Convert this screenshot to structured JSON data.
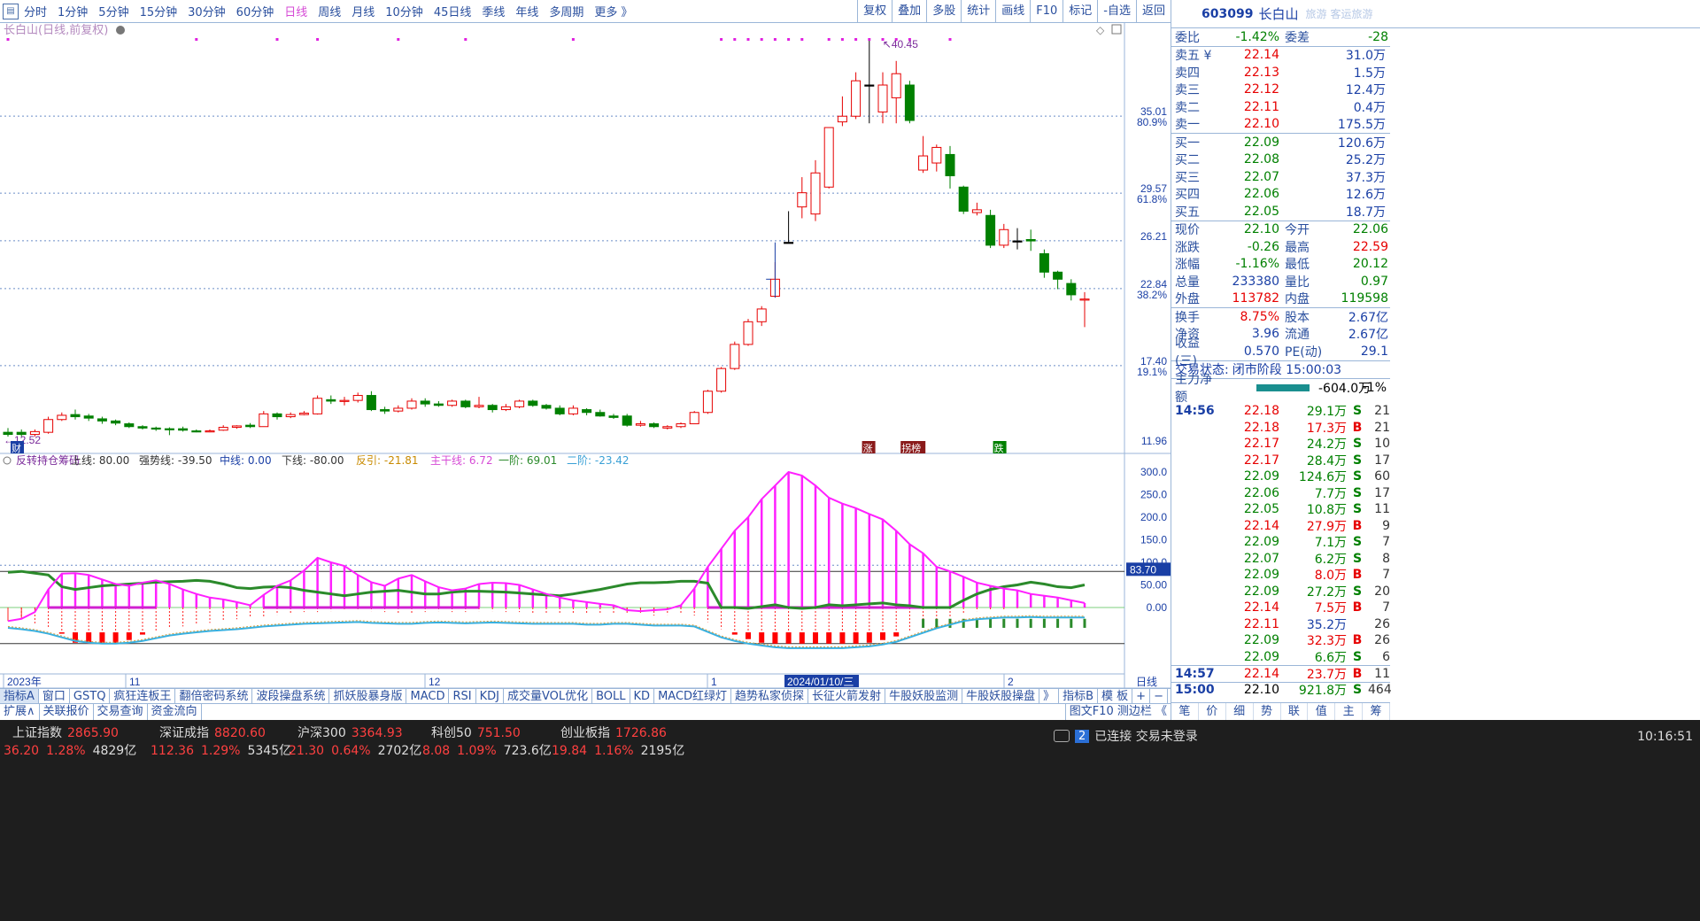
{
  "toolbar": {
    "periods": [
      "分时",
      "1分钟",
      "5分钟",
      "15分钟",
      "30分钟",
      "60分钟",
      "日线",
      "周线",
      "月线",
      "10分钟",
      "45日线",
      "季线",
      "年线",
      "多周期",
      "更多 》"
    ],
    "active": "日线",
    "right": [
      "复权",
      "叠加",
      "多股",
      "统计",
      "画线",
      "F10",
      "标记",
      "-自选",
      "返回"
    ]
  },
  "chart_title": "长白山(日线,前复权)",
  "price_labels": [
    "35.01",
    "80.9%",
    "29.57",
    "61.8%",
    "26.21",
    "22.84",
    "38.2%",
    "17.40",
    "19.1%",
    "11.96"
  ],
  "high_mark": "40.45",
  "low_mark": "12.52",
  "event_labels": [
    "财",
    "涨",
    "拐榜",
    "跌"
  ],
  "indicator_header": {
    "name": "反转持仓筹码",
    "items": [
      "上线: 80.00",
      "强势线: -39.50",
      "中线: 0.00",
      "下线: -80.00",
      "反引: -21.81",
      "主干线: 6.72",
      "一阶: 69.01",
      "二阶: -23.42"
    ]
  },
  "ind_axis": [
    "300.0",
    "250.0",
    "200.0",
    "150.0",
    "100.0",
    "50.00",
    "0.00"
  ],
  "ind_tag": "83.70",
  "x_labels": [
    "2023年",
    "11",
    "12",
    "1",
    "2"
  ],
  "x_highlight": "2024/01/10/三",
  "x_right": "日线",
  "stock": {
    "code": "603099",
    "name": "长白山",
    "tags": [
      "旅游",
      "客运旅游"
    ]
  },
  "weibi": {
    "label": "委比",
    "value": "-1.42%",
    "label2": "委差",
    "value2": "-28"
  },
  "asks": [
    {
      "label": "卖五 ¥",
      "price": "22.14",
      "vol": "31.0万"
    },
    {
      "label": "卖四",
      "price": "22.13",
      "vol": "1.5万"
    },
    {
      "label": "卖三",
      "price": "22.12",
      "vol": "12.4万"
    },
    {
      "label": "卖二",
      "price": "22.11",
      "vol": "0.4万"
    },
    {
      "label": "卖一",
      "price": "22.10",
      "vol": "175.5万"
    }
  ],
  "bids": [
    {
      "label": "买一",
      "price": "22.09",
      "vol": "120.6万"
    },
    {
      "label": "买二",
      "price": "22.08",
      "vol": "25.2万"
    },
    {
      "label": "买三",
      "price": "22.07",
      "vol": "37.3万"
    },
    {
      "label": "买四",
      "price": "22.06",
      "vol": "12.6万"
    },
    {
      "label": "买五",
      "price": "22.05",
      "vol": "18.7万"
    }
  ],
  "stats1": [
    {
      "l": "现价",
      "v": "22.10",
      "l2": "今开",
      "v2": "22.06",
      "c": "grn",
      "c2": "grn"
    },
    {
      "l": "涨跌",
      "v": "-0.26",
      "l2": "最高",
      "v2": "22.59",
      "c": "grn",
      "c2": "red"
    },
    {
      "l": "涨幅",
      "v": "-1.16%",
      "l2": "最低",
      "v2": "20.12",
      "c": "grn",
      "c2": "grn"
    },
    {
      "l": "总量",
      "v": "233380",
      "l2": "量比",
      "v2": "0.97",
      "c": "blu",
      "c2": "grn"
    },
    {
      "l": "外盘",
      "v": "113782",
      "l2": "内盘",
      "v2": "119598",
      "c": "red",
      "c2": "grn"
    }
  ],
  "stats2": [
    {
      "l": "换手",
      "v": "8.75%",
      "l2": "股本",
      "v2": "2.67亿",
      "c": "red",
      "c2": "blu"
    },
    {
      "l": "净资",
      "v": "3.96",
      "l2": "流通",
      "v2": "2.67亿",
      "c": "blu",
      "c2": "blu"
    },
    {
      "l": "收益(三)",
      "v": "0.570",
      "l2": "PE(动)",
      "v2": "29.1",
      "c": "blu",
      "c2": "blu"
    }
  ],
  "trade_state": {
    "label": "交易状态:",
    "value": "闭市阶段 15:00:03"
  },
  "main_net": {
    "label": "主力净额",
    "value": "-604.0万",
    "pct": "-1%"
  },
  "ticks": [
    {
      "t": "14:56",
      "p": "22.18",
      "v": "29.1万",
      "bs": "S",
      "n": "21"
    },
    {
      "t": "",
      "p": "22.18",
      "v": "17.3万",
      "bs": "B",
      "n": "21"
    },
    {
      "t": "",
      "p": "22.17",
      "v": "24.2万",
      "bs": "S",
      "n": "10"
    },
    {
      "t": "",
      "p": "22.17",
      "v": "28.4万",
      "bs": "S",
      "n": "17"
    },
    {
      "t": "",
      "p": "22.09",
      "v": "124.6万",
      "bs": "S",
      "n": "60"
    },
    {
      "t": "",
      "p": "22.06",
      "v": "7.7万",
      "bs": "S",
      "n": "17"
    },
    {
      "t": "",
      "p": "22.05",
      "v": "10.8万",
      "bs": "S",
      "n": "11"
    },
    {
      "t": "",
      "p": "22.14",
      "v": "27.9万",
      "bs": "B",
      "n": "9"
    },
    {
      "t": "",
      "p": "22.09",
      "v": "7.1万",
      "bs": "S",
      "n": "7"
    },
    {
      "t": "",
      "p": "22.07",
      "v": "6.2万",
      "bs": "S",
      "n": "8"
    },
    {
      "t": "",
      "p": "22.09",
      "v": "8.0万",
      "bs": "B",
      "n": "7"
    },
    {
      "t": "",
      "p": "22.09",
      "v": "27.2万",
      "bs": "S",
      "n": "20"
    },
    {
      "t": "",
      "p": "22.14",
      "v": "7.5万",
      "bs": "B",
      "n": "7"
    },
    {
      "t": "",
      "p": "22.11",
      "v": "35.2万",
      "bs": "",
      "n": "26"
    },
    {
      "t": "",
      "p": "22.09",
      "v": "32.3万",
      "bs": "B",
      "n": "26"
    },
    {
      "t": "",
      "p": "22.09",
      "v": "6.6万",
      "bs": "S",
      "n": "6"
    },
    {
      "t": "14:57",
      "p": "22.14",
      "v": "23.7万",
      "bs": "B",
      "n": "11"
    },
    {
      "t": "15:00",
      "p": "22.10",
      "v": "921.8万",
      "bs": "S",
      "n": "464"
    }
  ],
  "right_tabs": [
    "笔",
    "价",
    "细",
    "势",
    "联",
    "值",
    "主",
    "筹"
  ],
  "indicator_tabs": [
    "指标A",
    "窗口",
    "GSTQ",
    "疯狂连板王",
    "翻倍密码系统",
    "波段操盘系统",
    "抓妖股暴身版",
    "MACD",
    "RSI",
    "KDJ",
    "成交量VOL优化",
    "BOLL",
    "KD",
    "MACD红绿灯",
    "趋势私家侦探",
    "长征火箭发射",
    "牛股妖股监测",
    "牛股妖股操盘",
    "》",
    "指标B",
    "模 板",
    "+",
    "−"
  ],
  "indicator_tabs2": [
    "扩展∧",
    "关联报价",
    "交易查询",
    "资金流向"
  ],
  "f10_tab": "图文F10 测边栏 《",
  "indices": [
    {
      "name": "上证指数",
      "value": "2865.90",
      "chg": "36.20",
      "pct": "1.28%",
      "amt": "4829亿"
    },
    {
      "name": "深证成指",
      "value": "8820.60",
      "chg": "112.36",
      "pct": "1.29%",
      "amt": "5345亿"
    },
    {
      "name": "沪深300",
      "value": "3364.93",
      "chg": "21.30",
      "pct": "0.64%",
      "amt": "2702亿"
    },
    {
      "name": "科创50",
      "value": "751.50",
      "chg": "8.08",
      "pct": "1.09%",
      "amt": "723.6亿"
    },
    {
      "name": "创业板指",
      "value": "1726.86",
      "chg": "19.84",
      "pct": "1.16%",
      "amt": "2195亿"
    }
  ],
  "connection": {
    "badge": "2",
    "text": "已连接 交易未登录"
  },
  "clock": "10:16:51",
  "colors": {
    "up": "#e60000",
    "down": "#008000",
    "accent": "#d64bd6",
    "blue": "#1a3fa5"
  }
}
